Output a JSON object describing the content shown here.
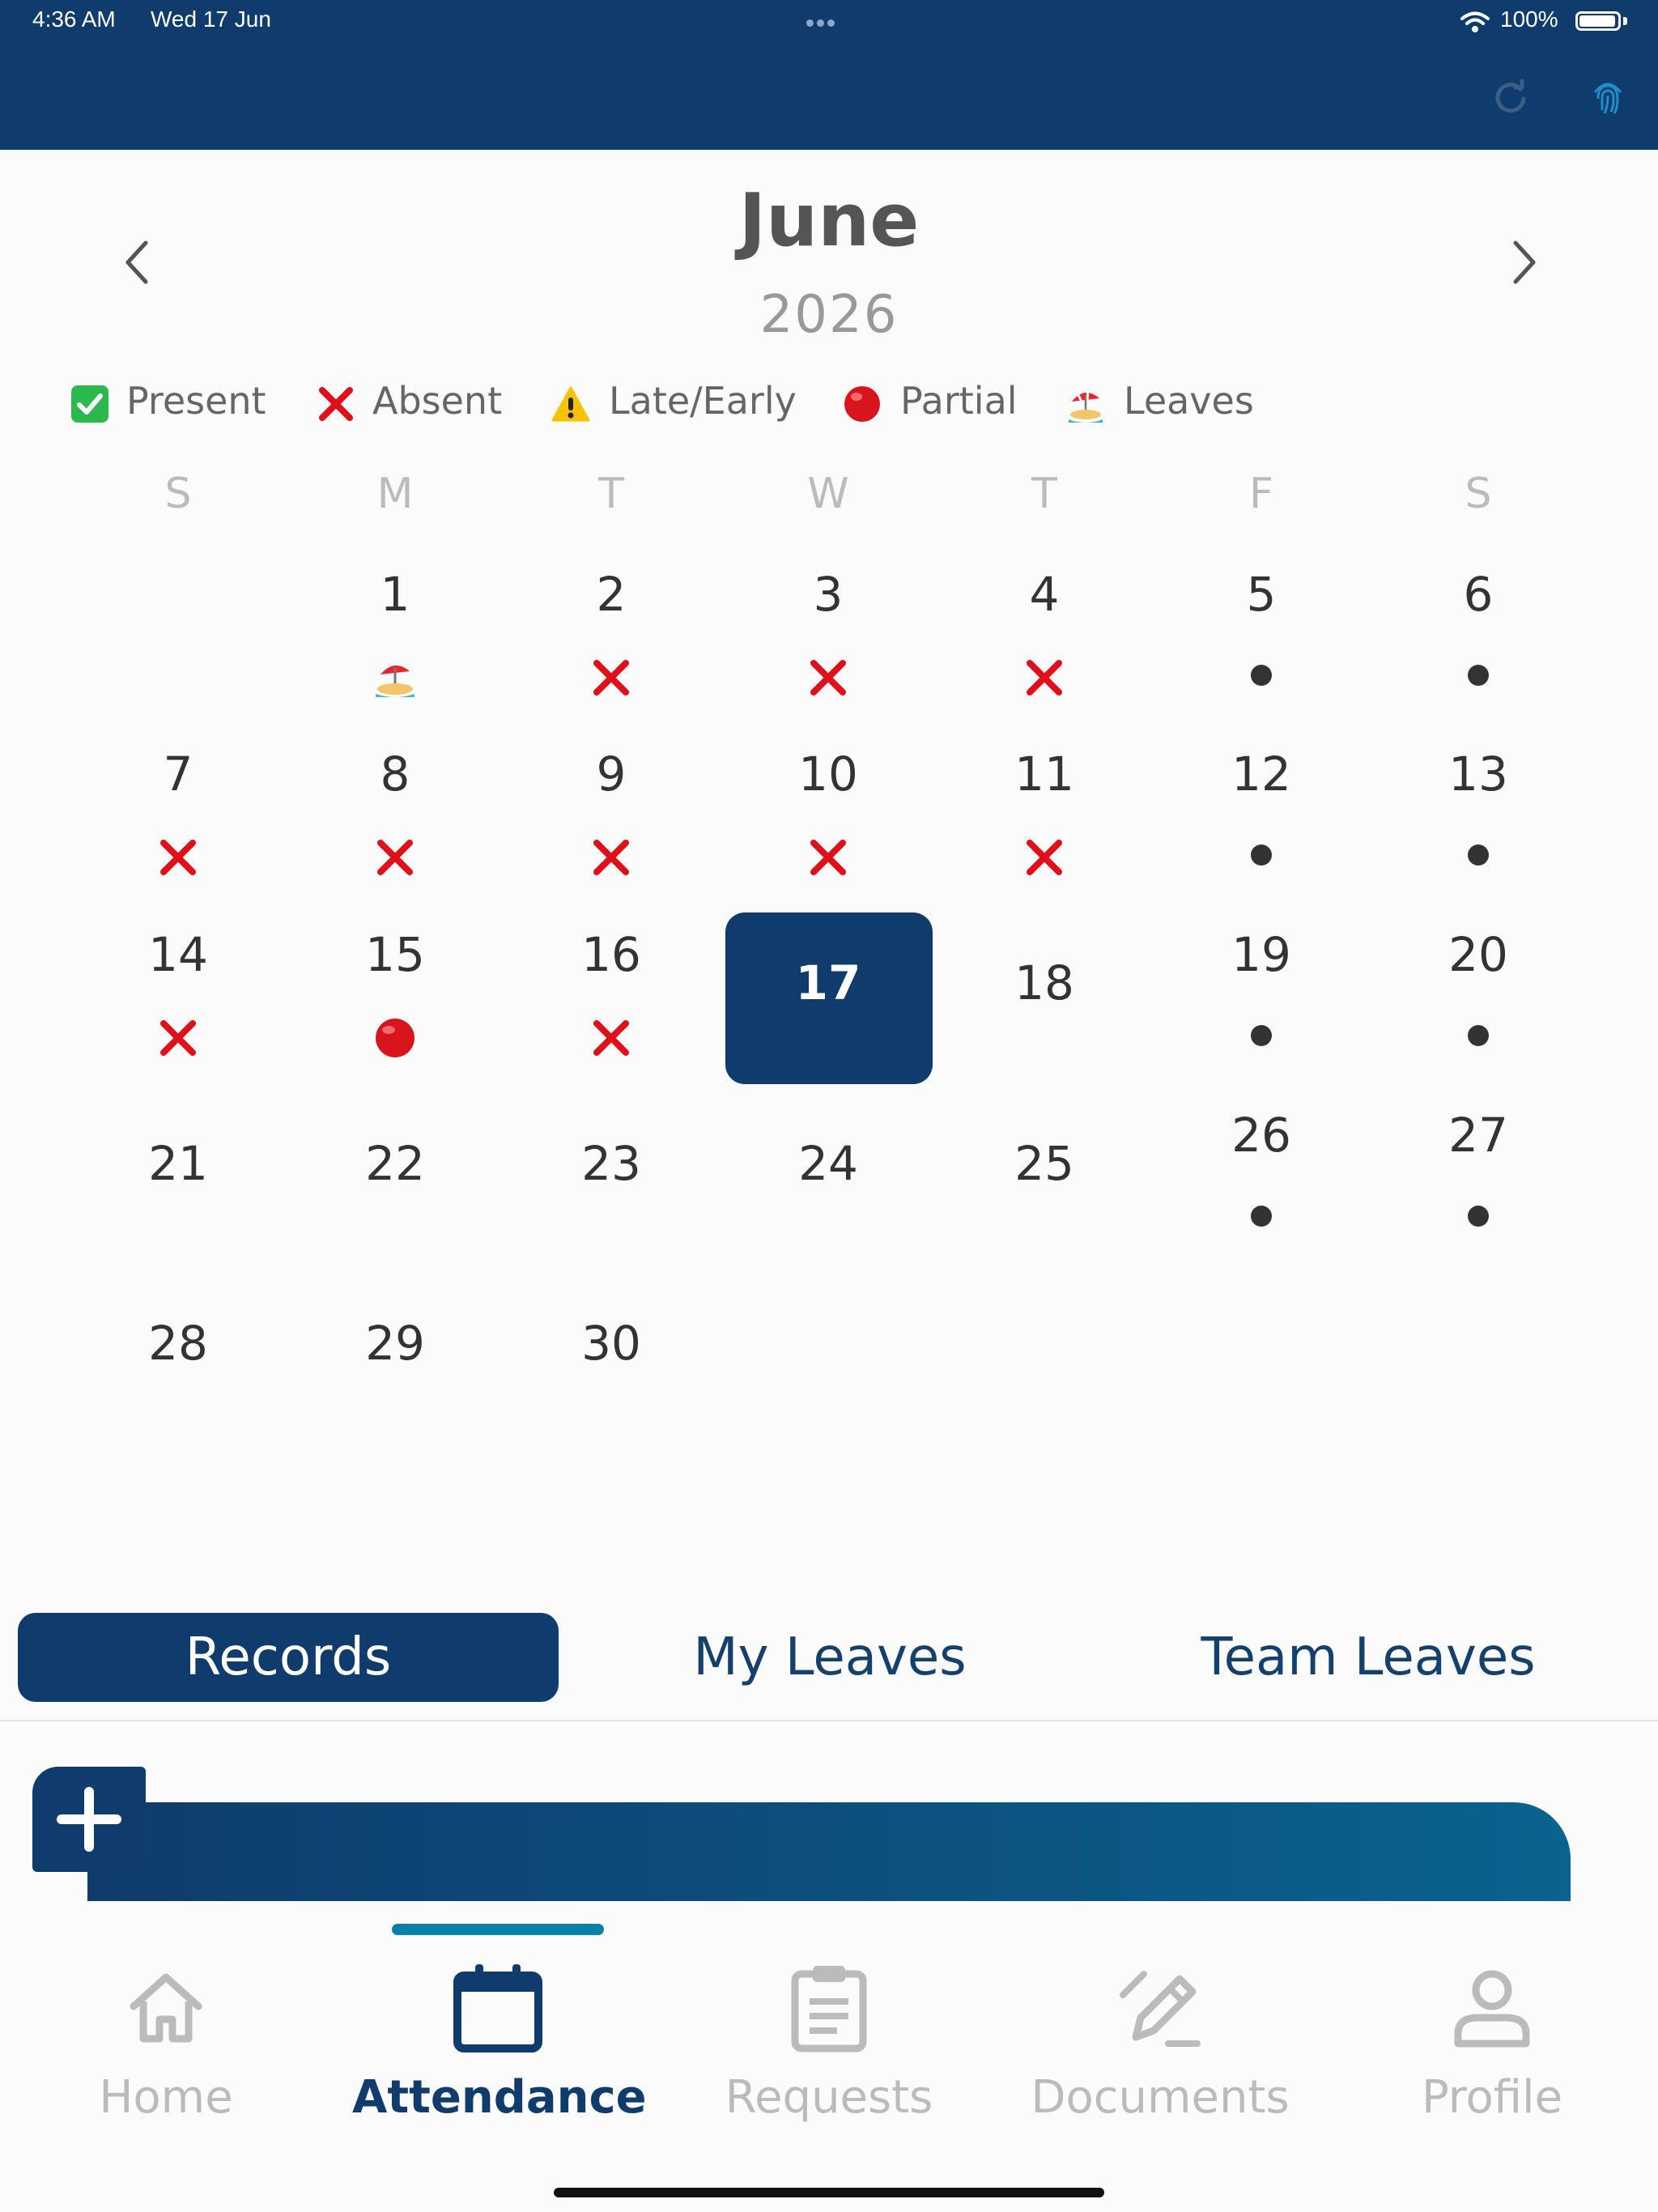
{
  "status_bar": {
    "time": "4:36 AM",
    "date": "Wed 17 Jun",
    "battery": "100%"
  },
  "header": {
    "background_color": "#0f3c6c",
    "icons": [
      "refresh-icon",
      "fingerprint-icon"
    ]
  },
  "calendar": {
    "month": "June",
    "year": "2026",
    "legend": [
      {
        "icon": "present-check-icon",
        "label": "Present",
        "color": "#2db84d"
      },
      {
        "icon": "absent-x-icon",
        "label": "Absent",
        "color": "#e0101a"
      },
      {
        "icon": "late-early-warning-icon",
        "label": "Late/Early",
        "color": "#f7c300"
      },
      {
        "icon": "partial-red-dot-icon",
        "label": "Partial",
        "color": "#d8141c"
      },
      {
        "icon": "leaves-beach-icon",
        "label": "Leaves",
        "color": "#f28a1a"
      }
    ],
    "weekdays": [
      "S",
      "M",
      "T",
      "W",
      "T",
      "F",
      "S"
    ],
    "days": [
      {
        "d": "1",
        "status": "leave"
      },
      {
        "d": "2",
        "status": "absent"
      },
      {
        "d": "3",
        "status": "absent"
      },
      {
        "d": "4",
        "status": "absent"
      },
      {
        "d": "5",
        "status": "weekend"
      },
      {
        "d": "6",
        "status": "weekend"
      },
      {
        "d": "7",
        "status": "absent"
      },
      {
        "d": "8",
        "status": "absent"
      },
      {
        "d": "9",
        "status": "absent"
      },
      {
        "d": "10",
        "status": "absent"
      },
      {
        "d": "11",
        "status": "absent"
      },
      {
        "d": "12",
        "status": "weekend"
      },
      {
        "d": "13",
        "status": "weekend"
      },
      {
        "d": "14",
        "status": "absent"
      },
      {
        "d": "15",
        "status": "partial"
      },
      {
        "d": "16",
        "status": "absent"
      },
      {
        "d": "17",
        "status": "today"
      },
      {
        "d": "18",
        "status": "none"
      },
      {
        "d": "19",
        "status": "weekend"
      },
      {
        "d": "20",
        "status": "weekend"
      },
      {
        "d": "21",
        "status": "none"
      },
      {
        "d": "22",
        "status": "none"
      },
      {
        "d": "23",
        "status": "none"
      },
      {
        "d": "24",
        "status": "none"
      },
      {
        "d": "25",
        "status": "none"
      },
      {
        "d": "26",
        "status": "weekend"
      },
      {
        "d": "27",
        "status": "weekend"
      },
      {
        "d": "28",
        "status": "none"
      },
      {
        "d": "29",
        "status": "none"
      },
      {
        "d": "30",
        "status": "none"
      }
    ],
    "first_weekday_index": 1,
    "selected_day": "17"
  },
  "tabs": [
    {
      "label": "Records",
      "active": true
    },
    {
      "label": "My Leaves",
      "active": false
    },
    {
      "label": "Team Leaves",
      "active": false
    }
  ],
  "bottom_nav": [
    {
      "label": "Home",
      "icon": "home-icon",
      "active": false
    },
    {
      "label": "Attendance",
      "icon": "calendar-icon",
      "active": true
    },
    {
      "label": "Requests",
      "icon": "clipboard-icon",
      "active": false
    },
    {
      "label": "Documents",
      "icon": "edit-document-icon",
      "active": false
    },
    {
      "label": "Profile",
      "icon": "person-icon",
      "active": false
    }
  ]
}
